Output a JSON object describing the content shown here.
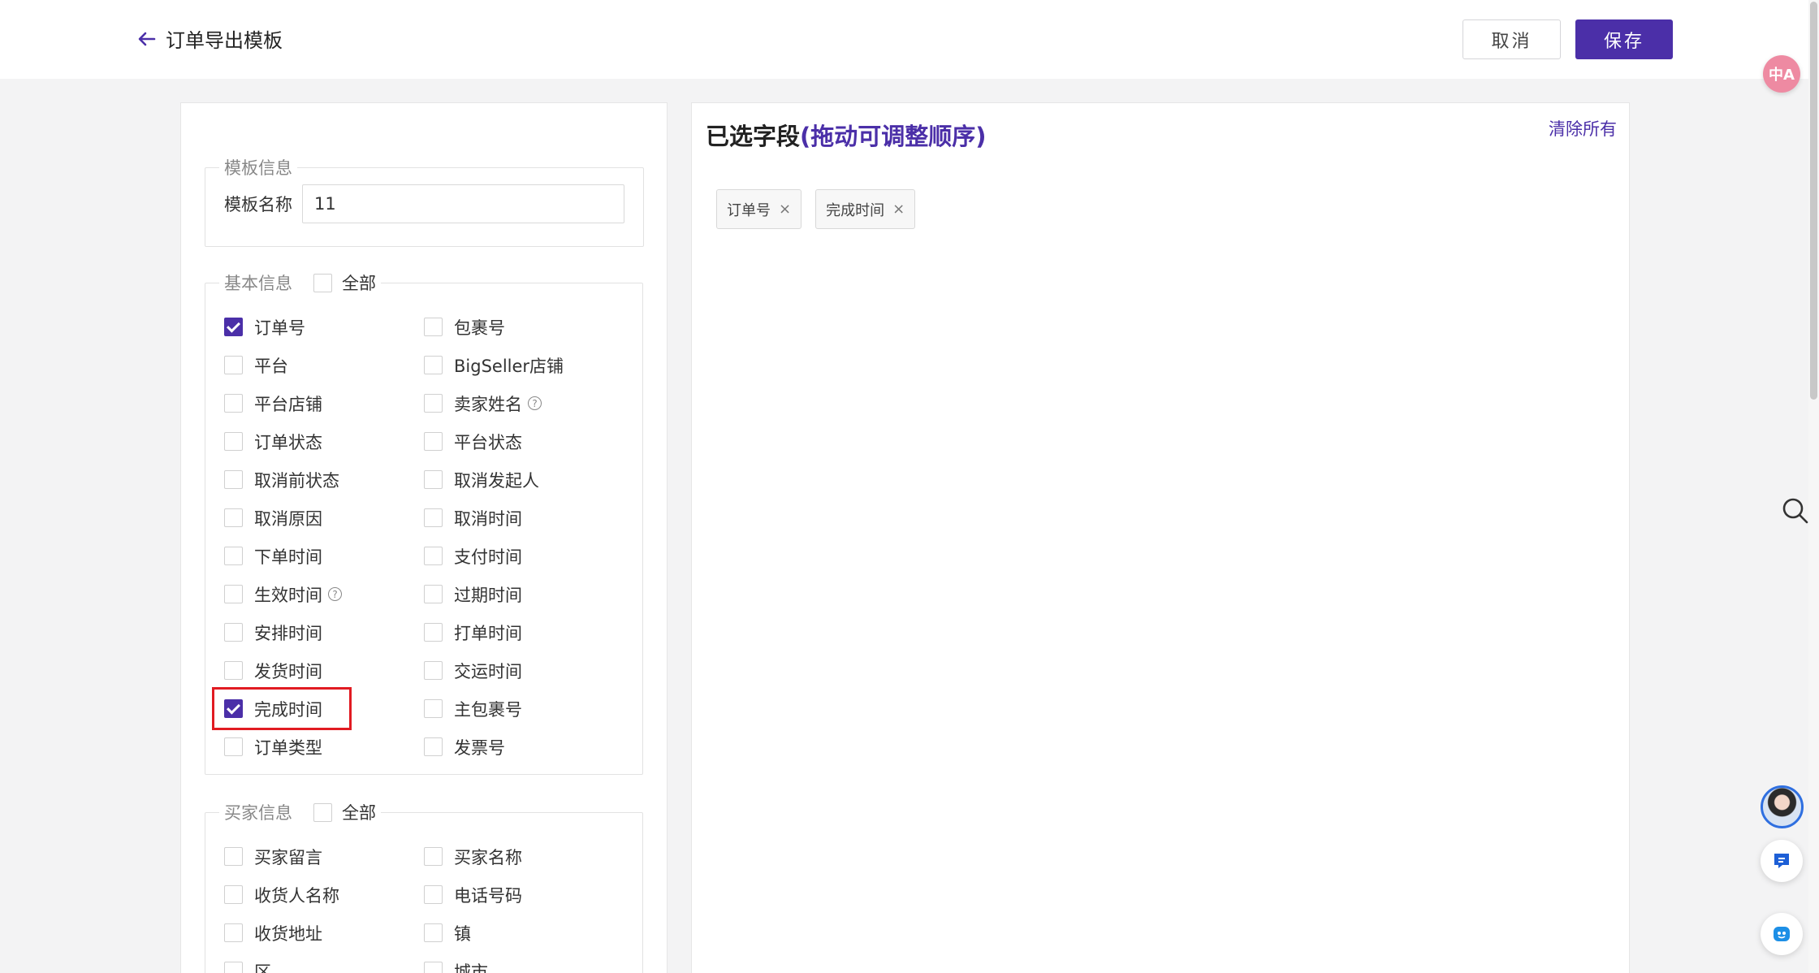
{
  "header": {
    "back_title": "订单导出模板",
    "cancel_label": "取消",
    "save_label": "保存"
  },
  "template_info": {
    "legend": "模板信息",
    "name_label": "模板名称",
    "name_value": "11"
  },
  "basic_info": {
    "legend": "基本信息",
    "all_label": "全部",
    "items": [
      {
        "label": "订单号",
        "checked": true
      },
      {
        "label": "包裹号",
        "checked": false
      },
      {
        "label": "平台",
        "checked": false
      },
      {
        "label": "BigSeller店铺",
        "checked": false
      },
      {
        "label": "平台店铺",
        "checked": false
      },
      {
        "label": "卖家姓名",
        "checked": false,
        "help": true
      },
      {
        "label": "订单状态",
        "checked": false
      },
      {
        "label": "平台状态",
        "checked": false
      },
      {
        "label": "取消前状态",
        "checked": false
      },
      {
        "label": "取消发起人",
        "checked": false
      },
      {
        "label": "取消原因",
        "checked": false
      },
      {
        "label": "取消时间",
        "checked": false
      },
      {
        "label": "下单时间",
        "checked": false
      },
      {
        "label": "支付时间",
        "checked": false
      },
      {
        "label": "生效时间",
        "checked": false,
        "help": true
      },
      {
        "label": "过期时间",
        "checked": false
      },
      {
        "label": "安排时间",
        "checked": false
      },
      {
        "label": "打单时间",
        "checked": false
      },
      {
        "label": "发货时间",
        "checked": false
      },
      {
        "label": "交运时间",
        "checked": false
      },
      {
        "label": "完成时间",
        "checked": true,
        "highlighted": true
      },
      {
        "label": "主包裹号",
        "checked": false
      },
      {
        "label": "订单类型",
        "checked": false
      },
      {
        "label": "发票号",
        "checked": false
      }
    ]
  },
  "buyer_info": {
    "legend": "买家信息",
    "all_label": "全部",
    "items": [
      {
        "label": "买家留言",
        "checked": false
      },
      {
        "label": "买家名称",
        "checked": false
      },
      {
        "label": "收货人名称",
        "checked": false
      },
      {
        "label": "电话号码",
        "checked": false
      },
      {
        "label": "收货地址",
        "checked": false
      },
      {
        "label": "镇",
        "checked": false
      },
      {
        "label": "区",
        "checked": false
      },
      {
        "label": "城市",
        "checked": false
      }
    ]
  },
  "selected": {
    "title_prefix": "已选字段",
    "title_hint": "(拖动可调整顺序)",
    "clear_all": "清除所有",
    "tags": [
      "订单号",
      "完成时间"
    ]
  },
  "floating": {
    "translate_badge": "中A"
  },
  "colors": {
    "accent": "#4b2fa8",
    "highlight": "#e11b22"
  }
}
